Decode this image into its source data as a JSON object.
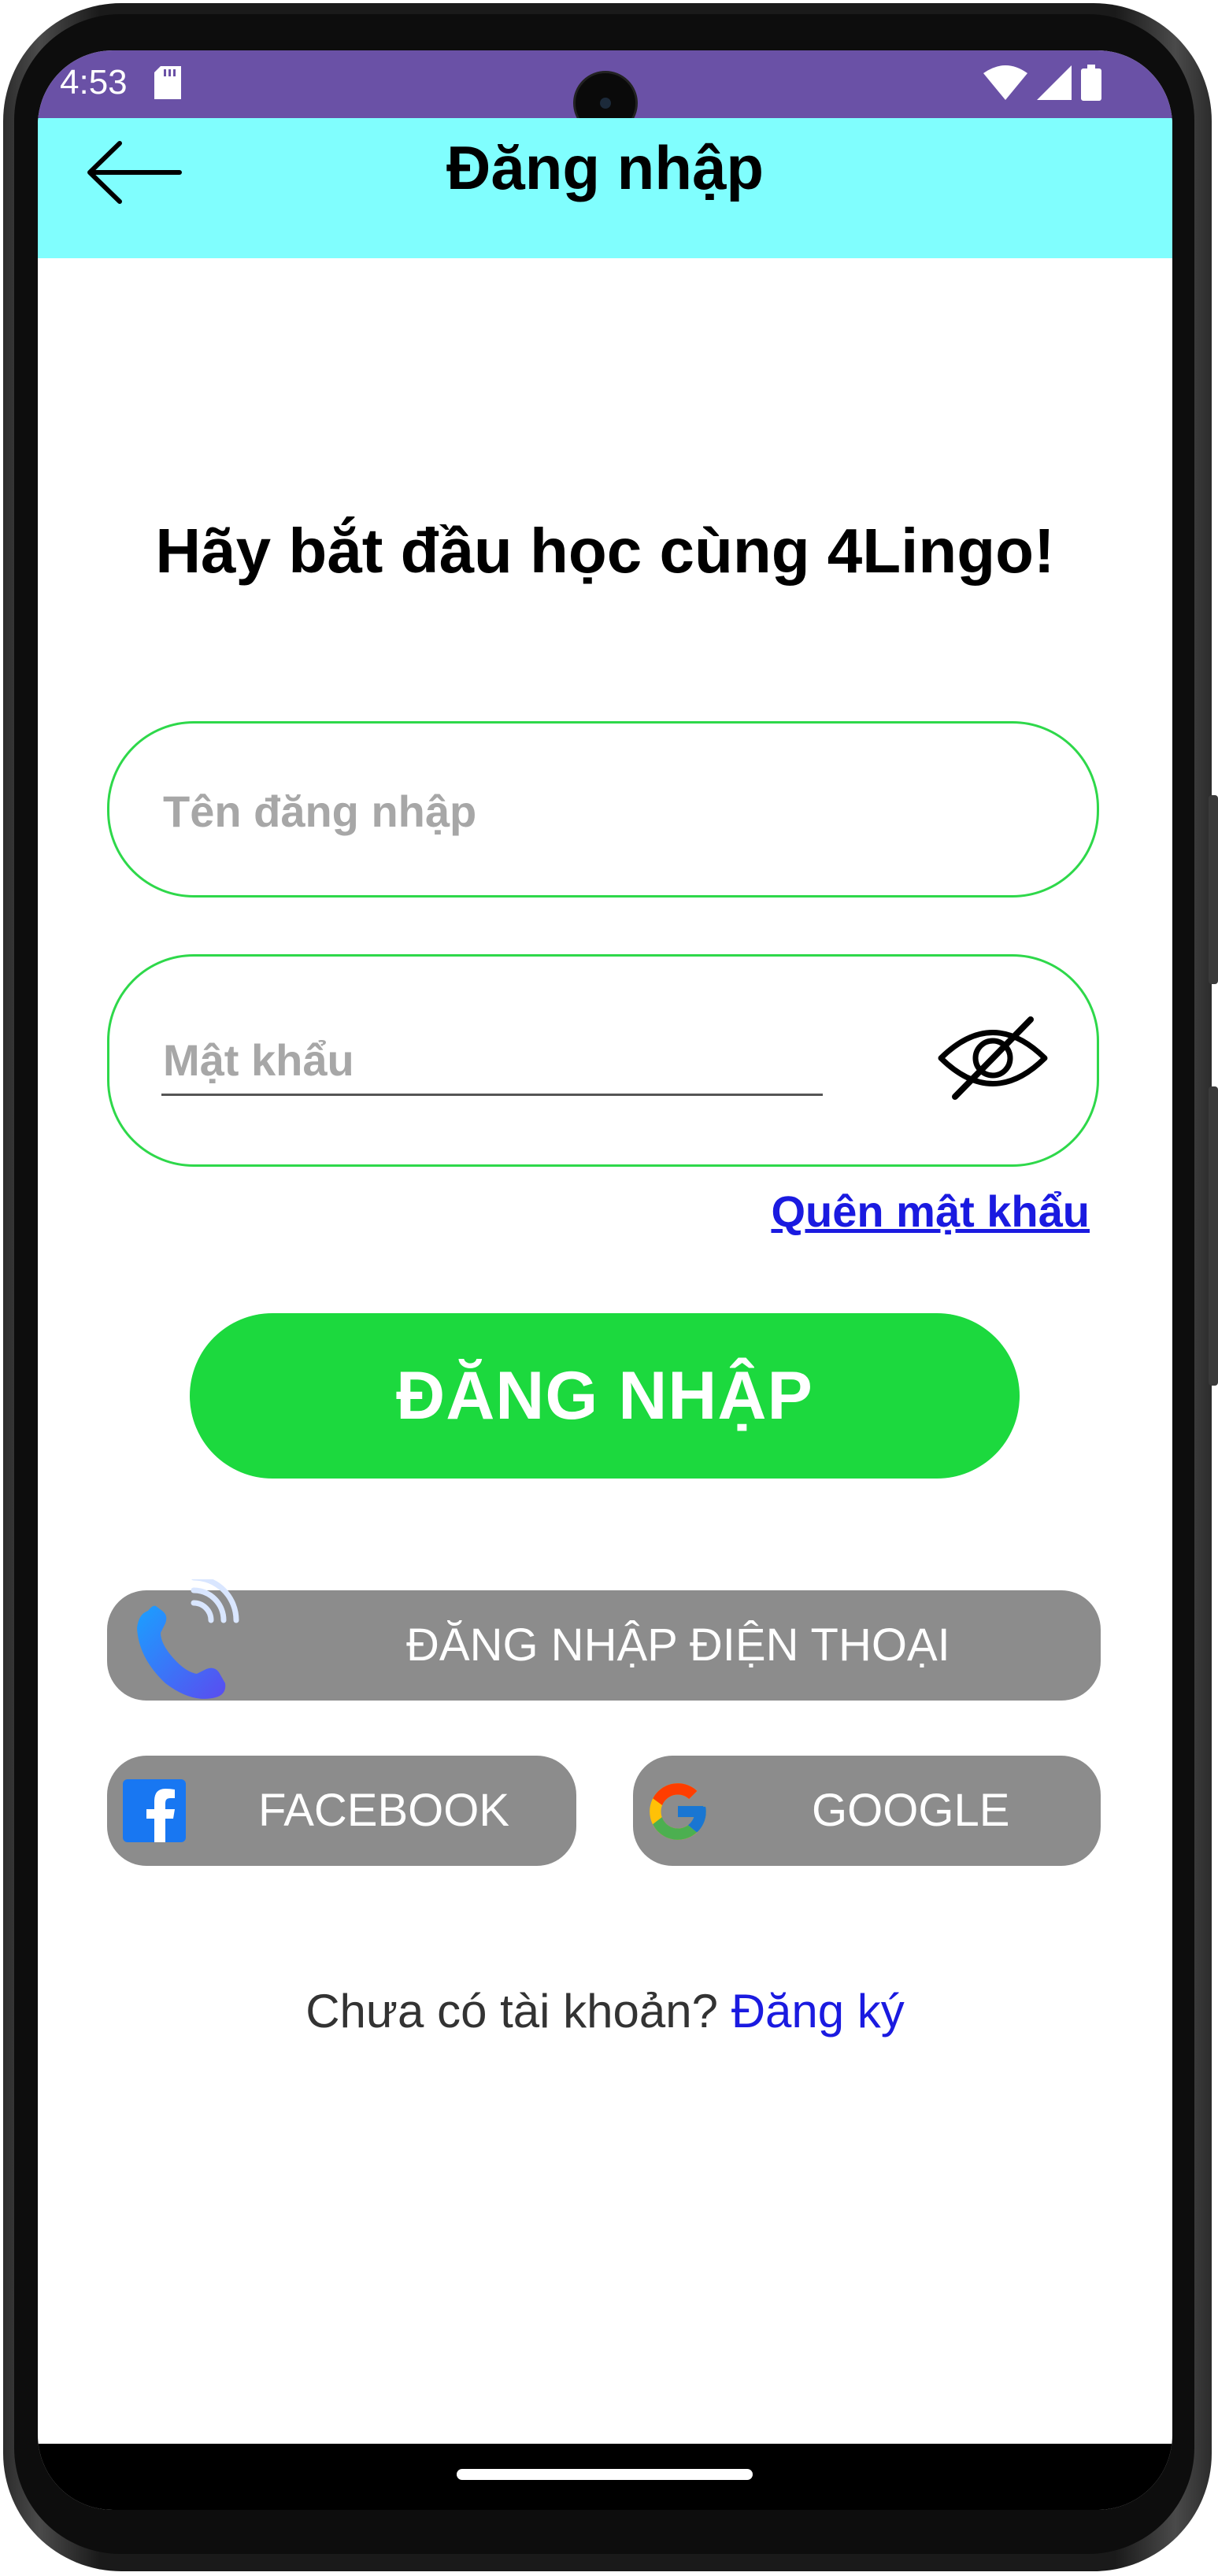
{
  "status_bar": {
    "time": "4:53",
    "icons": [
      "sd-card-icon",
      "wifi-icon",
      "signal-icon",
      "battery-icon"
    ],
    "background": "#6a51a6"
  },
  "app_bar": {
    "title": "Đăng nhập",
    "back_icon": "arrow-left-icon",
    "background": "#80fefe"
  },
  "headline": "Hãy bắt đầu học cùng 4Lingo!",
  "form": {
    "username": {
      "value": "",
      "placeholder": "Tên đăng nhập"
    },
    "password": {
      "value": "",
      "placeholder": "Mật khẩu",
      "toggle_icon": "eye-off-icon"
    },
    "forgot_password": "Quên mật khẩu",
    "login_button": "ĐĂNG NHẬP",
    "accent_color": "#1cd93e"
  },
  "social_login": {
    "phone": {
      "label": "ĐĂNG NHẬP ĐIỆN THOẠI",
      "icon": "phone-call-icon"
    },
    "facebook": {
      "label": "FACEBOOK",
      "icon": "facebook-icon"
    },
    "google": {
      "label": "GOOGLE",
      "icon": "google-icon"
    },
    "button_color": "#8c8c8c"
  },
  "signup": {
    "prompt": "Chưa có tài khoản?",
    "link": "Đăng ký"
  }
}
